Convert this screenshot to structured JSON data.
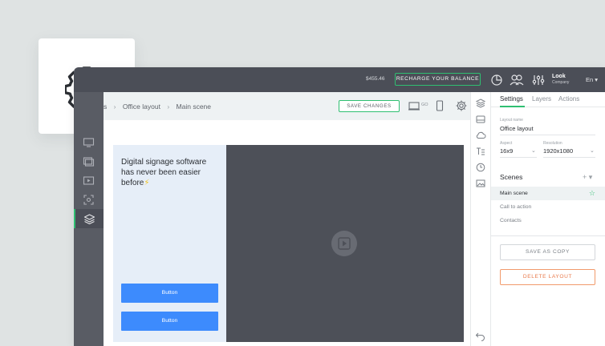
{
  "topbar": {
    "balance": "$455.46",
    "recharge_label": "RECHARGE YOUR BALANCE",
    "user_name": "Look",
    "user_company": "Company",
    "language": "En ▾"
  },
  "breadcrumb": {
    "items": [
      "s",
      "Office layout",
      "Main scene"
    ],
    "separator": "›"
  },
  "toolbar": {
    "save_label": "SAVE CHANGES",
    "device_go": "GO"
  },
  "canvas": {
    "headline": "Digital signage software has never been easier before",
    "headline_emoji": "⚡",
    "button_1": "Button",
    "button_2": "Button"
  },
  "settings": {
    "tabs": [
      "Settings",
      "Layers",
      "Actions"
    ],
    "layout_name_label": "Layout name",
    "layout_name_value": "Office layout",
    "aspect_label": "Aspect",
    "aspect_value": "16x9",
    "resolution_label": "Resolution",
    "resolution_value": "1920x1080",
    "scenes_title": "Scenes",
    "scenes_actions": "+ ▾",
    "scenes": [
      "Main scene",
      "Call to action",
      "Contacts"
    ],
    "save_as_copy": "SAVE AS COPY",
    "delete_layout": "DELETE LAYOUT"
  },
  "colors": {
    "accent_green": "#2fbf71",
    "topbar": "#4b4e57",
    "button_blue": "#3d8bfd",
    "delete_orange": "#e8794a"
  }
}
